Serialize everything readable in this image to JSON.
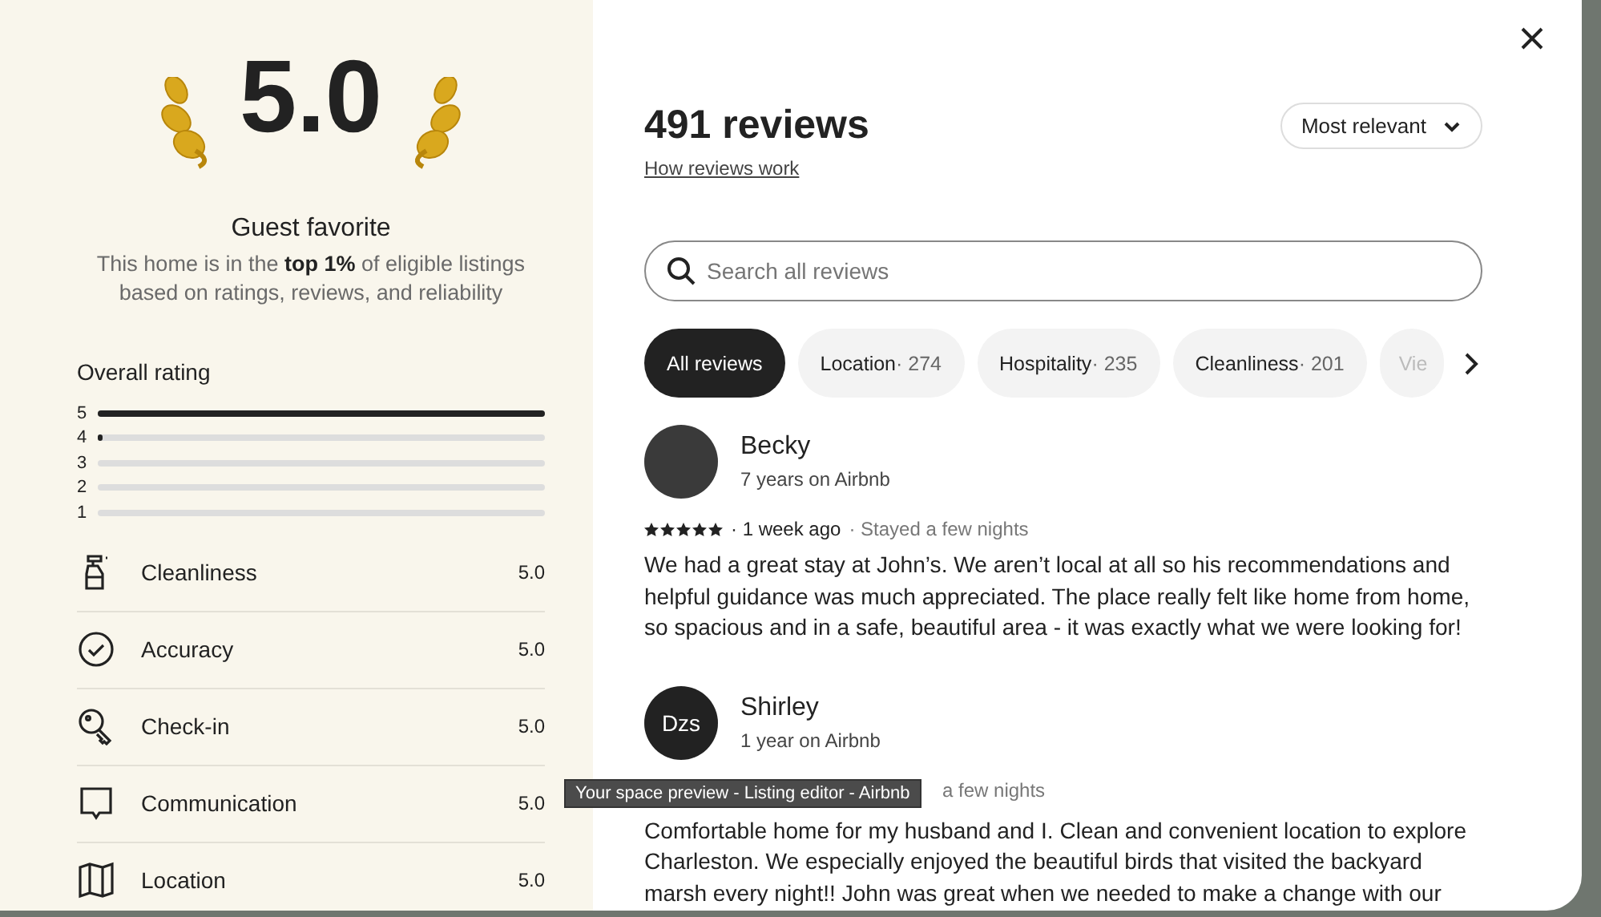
{
  "summary": {
    "score": "5.0",
    "badge": "Guest favorite",
    "description": "This home is in the **top 1%** of eligible listings based on ratings, reviews, and reliability"
  },
  "overall_rating": {
    "title": "Overall rating",
    "bars": [
      {
        "label": "5",
        "level": 1.0
      },
      {
        "label": "4",
        "level": 0.01
      },
      {
        "label": "3",
        "level": 0
      },
      {
        "label": "2",
        "level": 0
      },
      {
        "label": "1",
        "level": 0
      }
    ]
  },
  "categories": [
    {
      "kind": "spray",
      "name": "Cleanliness",
      "score": "5.0"
    },
    {
      "kind": "check",
      "name": "Accuracy",
      "score": "5.0"
    },
    {
      "kind": "key",
      "name": "Check-in",
      "score": "5.0"
    },
    {
      "kind": "chat",
      "name": "Communication",
      "score": "5.0"
    },
    {
      "kind": "map",
      "name": "Location",
      "score": "5.0"
    }
  ],
  "header": {
    "title": "491 reviews",
    "link": "How reviews work",
    "sort": "Most relevant"
  },
  "search": {
    "placeholder": "Search all reviews"
  },
  "filters": [
    {
      "label": "All reviews",
      "selected": true
    },
    {
      "label": "Location",
      "count": "· 274",
      "selected": false
    },
    {
      "label": "Hospitality",
      "count": "· 235",
      "selected": false
    },
    {
      "label": "Cleanliness",
      "count": "· 201",
      "selected": false
    },
    {
      "label": "Vie",
      "selected": false
    }
  ],
  "reviews": [
    {
      "name": "Becky",
      "tenure": "7 years on Airbnb",
      "kind": "photo",
      "stars": 5,
      "when": "· 1 week ago",
      "stay": "· Stayed a few nights",
      "text": "We had a great stay at John’s. We aren’t local at all so his recommendations and helpful guidance was much appreciated. The place really felt like home from home, so spacious and in a safe, beautiful area - it was exactly what we were looking for!"
    },
    {
      "name": "Shirley",
      "tenure": "1 year on Airbnb",
      "kind": "initials",
      "initials": "Dzs",
      "stay": "a few nights",
      "text": "Comfortable home for my husband and I. Clean and convenient location to explore Charleston. We especially enjoyed the beautiful birds that visited the backyard marsh every night!!  John was great when we needed to make a change with our"
    }
  ],
  "tooltip": "Your space preview - Listing editor - Airbnb"
}
